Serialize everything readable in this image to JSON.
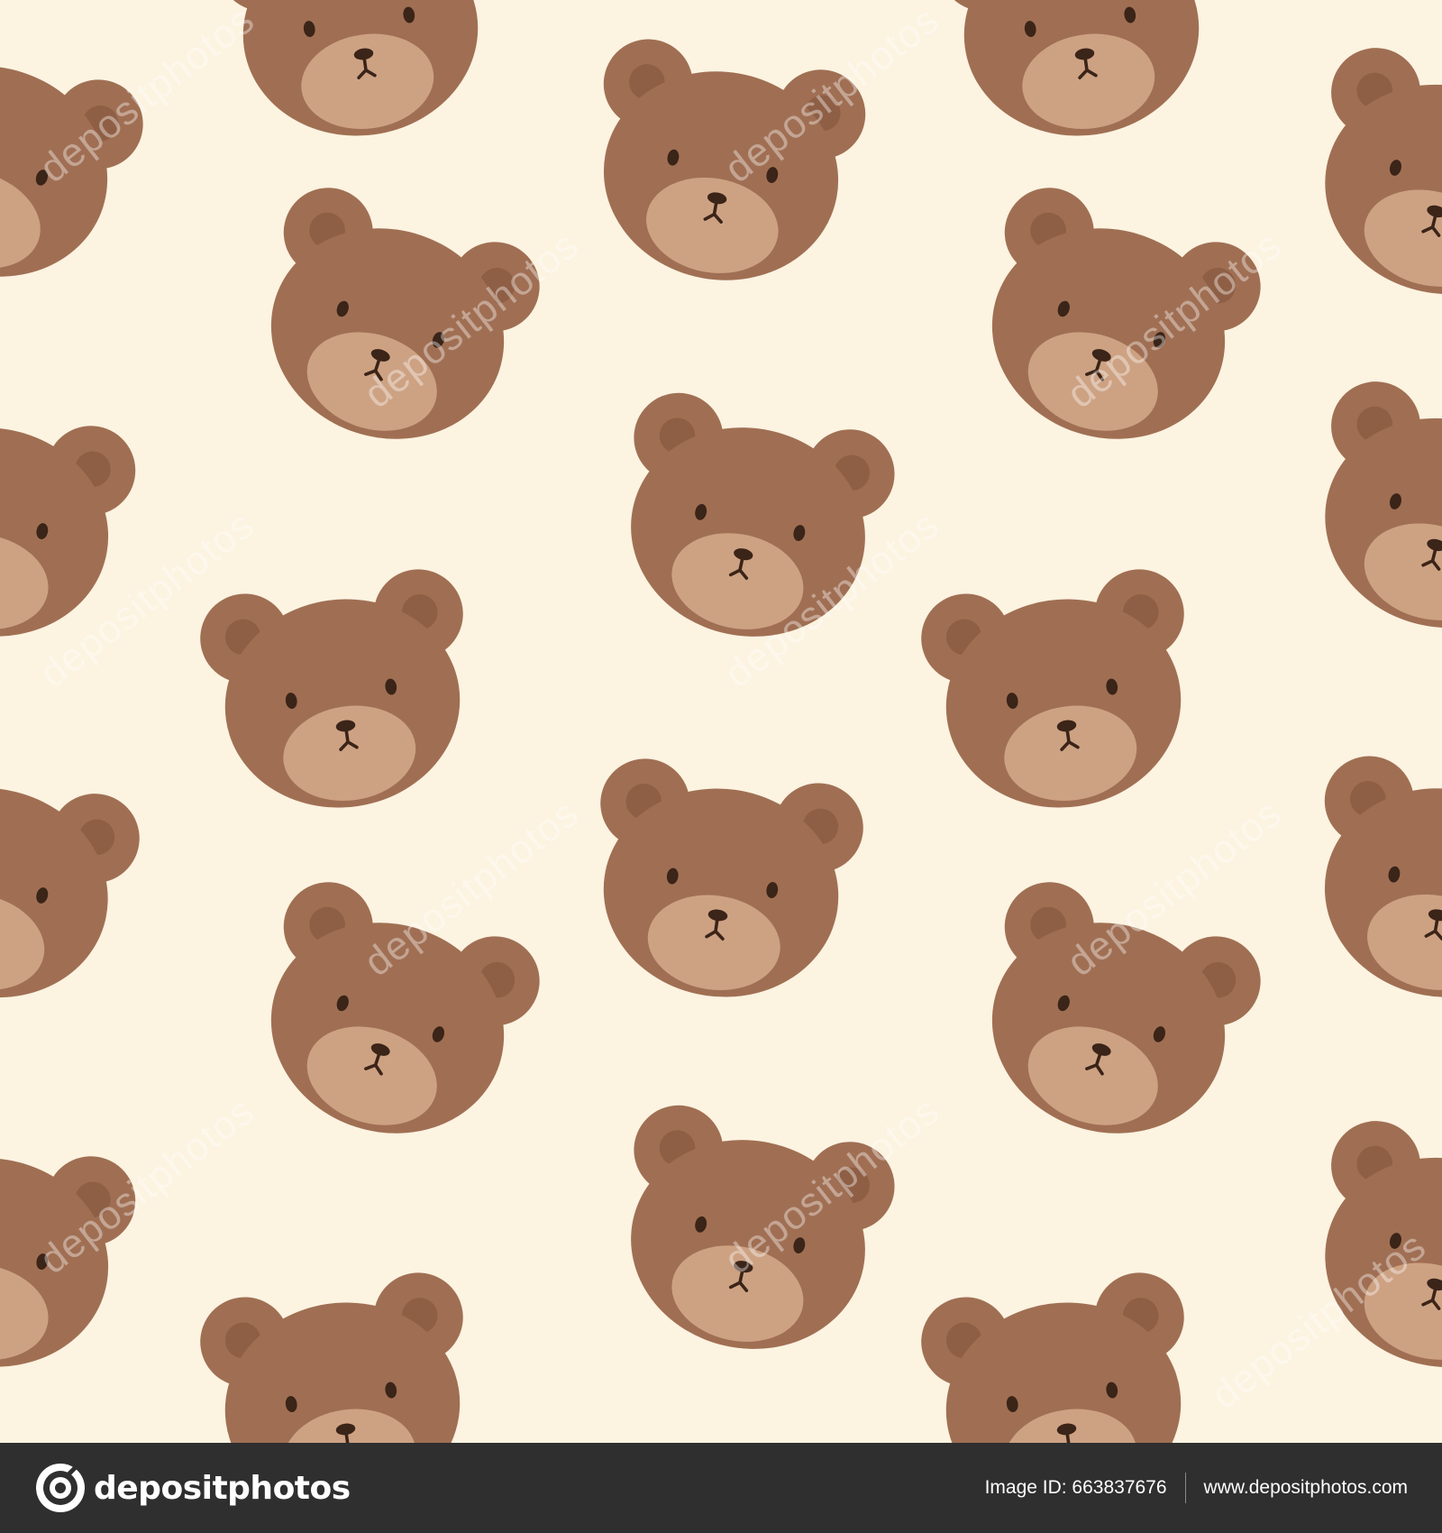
{
  "colors": {
    "background": "#fcf3e1",
    "bear_fur": "#a06f53",
    "bear_inner_ear": "#8f5f45",
    "bear_muzzle": "#cda283",
    "bear_features": "#3b2418",
    "footer_bg": "#2f2f2f"
  },
  "watermark": {
    "text": "depositphotos"
  },
  "footer": {
    "brand_icon": "depositphotos-logo-icon",
    "brand_name": "depositphotos",
    "image_id": "Image ID: 663837676",
    "website": "www.depositphotos.com"
  }
}
